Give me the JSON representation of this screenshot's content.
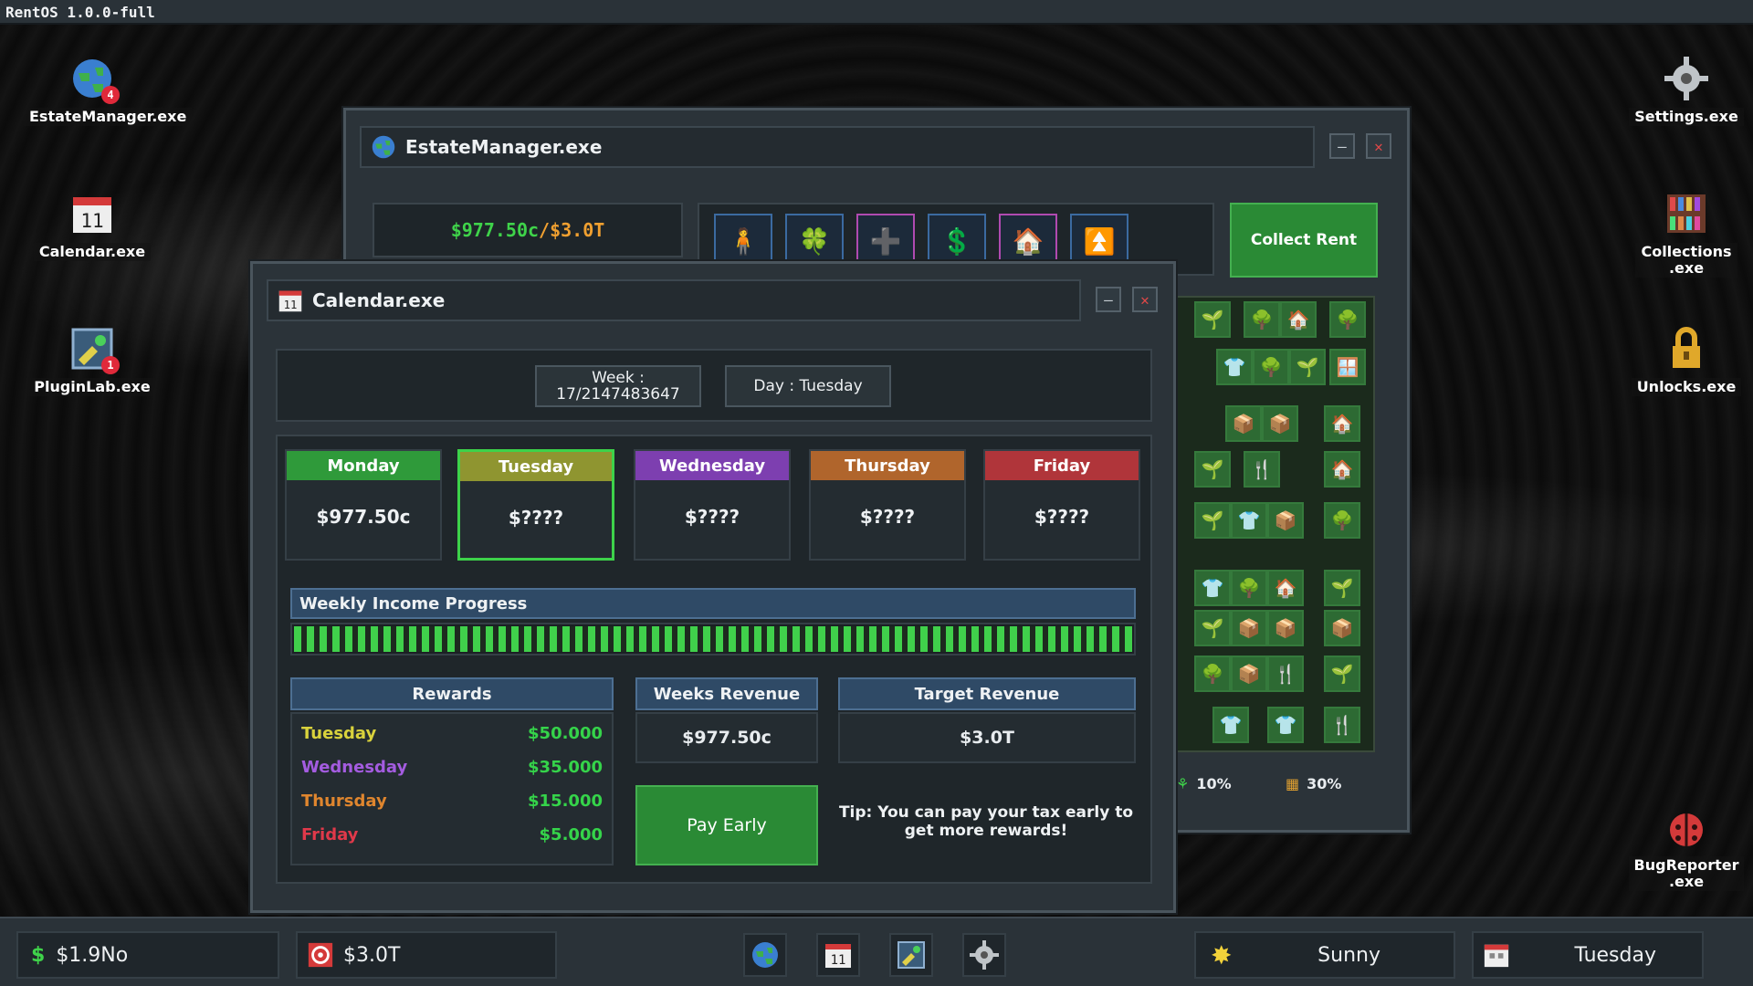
{
  "system": {
    "title": "RentOS 1.0.0-full"
  },
  "desktop_left": [
    {
      "label": "EstateManager.exe",
      "badge": "4"
    },
    {
      "label": "Calendar.exe",
      "glyph": "11"
    },
    {
      "label": "PluginLab.exe",
      "badge": "1"
    }
  ],
  "desktop_right": [
    {
      "label": "Settings.exe"
    },
    {
      "label_line1": "Collections",
      "label_line2": ".exe"
    },
    {
      "label": "Unlocks.exe"
    },
    {
      "label_line1": "BugReporter",
      "label_line2": ".exe"
    }
  ],
  "estate_window": {
    "title": "EstateManager.exe",
    "money_current": "$977.50c",
    "money_target": "/$3.0T",
    "collect_label": "Collect Rent",
    "stats": [
      {
        "icon": "sprout-icon",
        "value": "10%"
      },
      {
        "icon": "house-icon",
        "value": "30%"
      }
    ]
  },
  "calendar_window": {
    "title": "Calendar.exe",
    "icon_text": "11",
    "week_label": "Week :",
    "week_value": "17/2147483647",
    "day_label": "Day : Tuesday",
    "days": [
      {
        "name": "Monday",
        "value": "$977.50c",
        "color": "#2f9a3a"
      },
      {
        "name": "Tuesday",
        "value": "$????",
        "color": "#8f9530"
      },
      {
        "name": "Wednesday",
        "value": "$????",
        "color": "#7d3fb0"
      },
      {
        "name": "Thursday",
        "value": "$????",
        "color": "#b0652c"
      },
      {
        "name": "Friday",
        "value": "$????",
        "color": "#b0353a"
      }
    ],
    "selected_day": "Tuesday",
    "progress_label": "Weekly Income Progress",
    "progress_fraction": 1.0,
    "rewards_label": "Rewards",
    "rewards": [
      {
        "day": "Tuesday",
        "amount": "$50.000",
        "color": "#d9d23c"
      },
      {
        "day": "Wednesday",
        "amount": "$35.000",
        "color": "#a45ce0"
      },
      {
        "day": "Thursday",
        "amount": "$15.000",
        "color": "#e0862e"
      },
      {
        "day": "Friday",
        "amount": "$5.000",
        "color": "#e0394a"
      }
    ],
    "weeks_revenue_label": "Weeks Revenue",
    "weeks_revenue_value": "$977.50c",
    "target_revenue_label": "Target Revenue",
    "target_revenue_value": "$3.0T",
    "pay_early_label": "Pay Early",
    "tip": "Tip: You can pay your tax early to get more rewards!"
  },
  "taskbar": {
    "money": "$1.9No",
    "target": "$3.0T",
    "calendar_glyph": "11",
    "weather": "Sunny",
    "day": "Tuesday"
  }
}
